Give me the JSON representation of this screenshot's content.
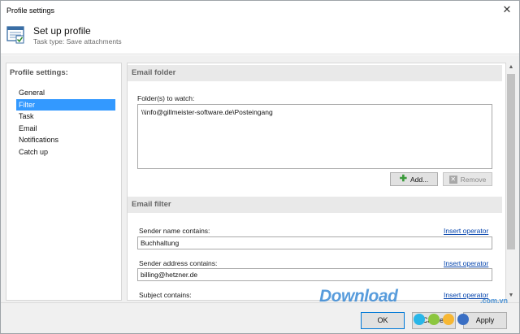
{
  "window": {
    "title": "Profile settings"
  },
  "header": {
    "title": "Set up profile",
    "subtitle": "Task type: Save attachments",
    "icon": "settings-form-icon"
  },
  "sidebar": {
    "heading": "Profile settings:",
    "items": [
      {
        "label": "General",
        "active": false
      },
      {
        "label": "Filter",
        "active": true
      },
      {
        "label": "Task",
        "active": false
      },
      {
        "label": "Email",
        "active": false
      },
      {
        "label": "Notifications",
        "active": false
      },
      {
        "label": "Catch up",
        "active": false
      }
    ]
  },
  "email_folder": {
    "heading": "Email folder",
    "label": "Folder(s) to watch:",
    "folders": [
      "\\\\info@gillmeister-software.de\\Posteingang"
    ],
    "add_label": "Add...",
    "remove_label": "Remove"
  },
  "email_filter": {
    "heading": "Email filter",
    "sender_name": {
      "label": "Sender name contains:",
      "value": "Buchhaltung",
      "link": "Insert operator"
    },
    "sender_address": {
      "label": "Sender address contains:",
      "value": "billing@hetzner.de",
      "link": "Insert operator"
    },
    "subject": {
      "label": "Subject contains:",
      "value": "",
      "link": "Insert operator"
    }
  },
  "footer": {
    "ok_label": "OK",
    "cancel_label": "Cancel",
    "apply_label": "Apply"
  },
  "watermark": {
    "text": "Download",
    "suffix": ".com.vn",
    "dot_colors": [
      "#29b6e8",
      "#8cc63f",
      "#f7b733",
      "#3a6fc4"
    ]
  },
  "colors": {
    "selection": "#3399ff",
    "link": "#0645ad",
    "ok_border": "#0078d7",
    "add_icon": "#3a9a3a"
  }
}
